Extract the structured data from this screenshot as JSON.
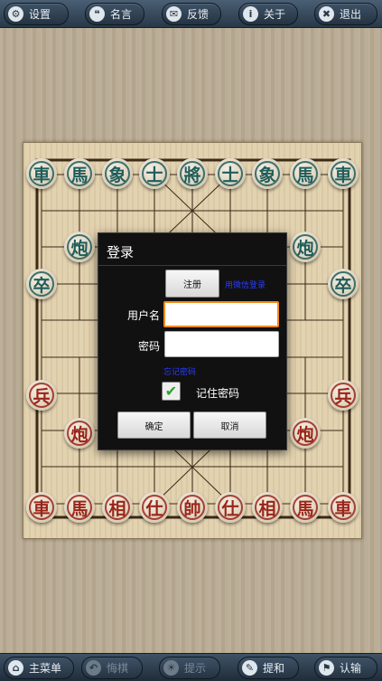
{
  "topbar": {
    "buttons": [
      {
        "label": "设置",
        "icon": "gear-icon",
        "glyph": "⚙"
      },
      {
        "label": "名言",
        "icon": "speech-bubble-icon",
        "glyph": "💬"
      },
      {
        "label": "反馈",
        "icon": "mail-icon",
        "glyph": "✉"
      },
      {
        "label": "关于",
        "icon": "info-icon",
        "glyph": "i"
      },
      {
        "label": "退出",
        "icon": "close-icon",
        "glyph": "✖"
      }
    ]
  },
  "board": {
    "black_top": [
      "車",
      "馬",
      "象",
      "士",
      "將",
      "士",
      "象",
      "馬",
      "車"
    ],
    "black_cannon": "炮",
    "black_soldier": "卒",
    "red_bottom": [
      "車",
      "馬",
      "相",
      "仕",
      "帥",
      "仕",
      "相",
      "馬",
      "車"
    ],
    "red_cannon": "炮",
    "red_soldier": "兵"
  },
  "dialog": {
    "title": "登录",
    "register_button": "注册",
    "register_link": "用微信登录",
    "username_label": "用户名",
    "username_value": "",
    "password_label": "密码",
    "password_value": "",
    "forgot_link": "忘记密码",
    "remember_label": "记住密码",
    "remember_checked": true,
    "confirm_button": "确定",
    "cancel_button": "取消"
  },
  "bottombar": {
    "buttons": [
      {
        "label": "主菜单",
        "icon": "home-icon",
        "glyph": "⌂",
        "enabled": true
      },
      {
        "label": "悔棋",
        "icon": "undo-icon",
        "glyph": "↶",
        "enabled": false
      },
      {
        "label": "提示",
        "icon": "bulb-icon",
        "glyph": "☀",
        "enabled": false
      },
      {
        "label": "提和",
        "icon": "pencil-icon",
        "glyph": "✎",
        "enabled": true
      },
      {
        "label": "认输",
        "icon": "flag-icon",
        "glyph": "⚑",
        "enabled": true
      }
    ]
  },
  "colors": {
    "black_piece": "#1f5d5a",
    "red_piece": "#9a2418",
    "focus": "#f08a1a",
    "link": "#2b3cff"
  }
}
